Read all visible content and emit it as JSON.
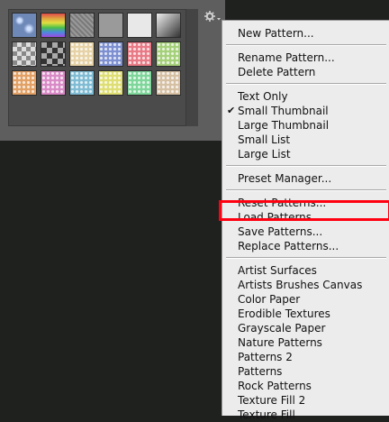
{
  "menu": {
    "groups": [
      [
        "New Pattern..."
      ],
      [
        "Rename Pattern...",
        "Delete Pattern"
      ],
      [
        "Text Only",
        "Small Thumbnail",
        "Large Thumbnail",
        "Small List",
        "Large List"
      ],
      [
        "Preset Manager..."
      ],
      [
        "Reset Patterns...",
        "Load Patterns...",
        "Save Patterns...",
        "Replace Patterns..."
      ],
      [
        "Artist Surfaces",
        "Artists Brushes Canvas",
        "Color Paper",
        "Erodible Textures",
        "Grayscale Paper",
        "Nature Patterns",
        "Patterns 2",
        "Patterns",
        "Rock Patterns",
        "Texture Fill 2",
        "Texture Fill"
      ]
    ],
    "checked_item": "Small Thumbnail",
    "check_glyph": "✔",
    "highlighted_item": "Load Patterns..."
  },
  "picker": {
    "gear_icon": "gear-icon",
    "swatches": [
      {
        "color": "#6e88b8",
        "style": "bubbles"
      },
      {
        "color": "#d04a7a",
        "style": "rainbow"
      },
      {
        "color": "#8a8a8a",
        "style": "noise"
      },
      {
        "color": "#9a9a9a",
        "style": "flat"
      },
      {
        "color": "#e8e8e8",
        "style": "flat"
      },
      {
        "color": "#555555",
        "style": "gradient"
      },
      {
        "color": "#777777",
        "style": "checker-light"
      },
      {
        "color": "#666666",
        "style": "checker-dark"
      },
      {
        "color": "#e6d2a6",
        "style": "dots"
      },
      {
        "color": "#7d8fd0",
        "style": "dots"
      },
      {
        "color": "#e87a86",
        "style": "dots"
      },
      {
        "color": "#a5d07a",
        "style": "dots"
      },
      {
        "color": "#e2a064",
        "style": "dots"
      },
      {
        "color": "#d98ac6",
        "style": "dots"
      },
      {
        "color": "#7fbcd4",
        "style": "dots"
      },
      {
        "color": "#dede74",
        "style": "dots"
      },
      {
        "color": "#7ed69a",
        "style": "dots"
      },
      {
        "color": "#d6c0a4",
        "style": "dots"
      }
    ],
    "highlight_color": "#ff0010"
  }
}
